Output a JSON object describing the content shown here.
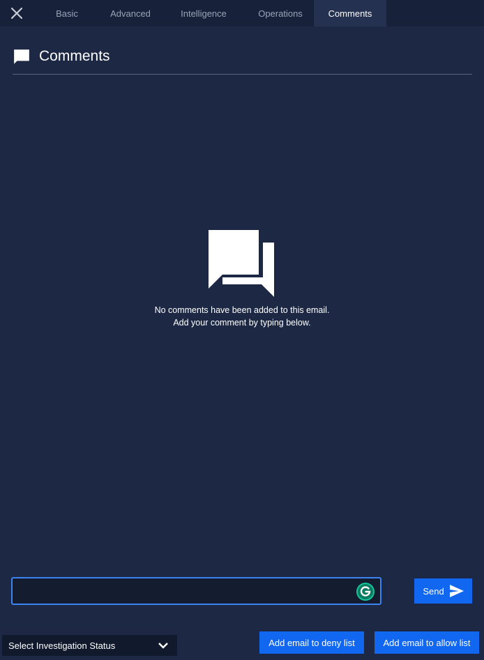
{
  "tabs": [
    {
      "label": "Basic",
      "active": false
    },
    {
      "label": "Advanced",
      "active": false
    },
    {
      "label": "Intelligence",
      "active": false
    },
    {
      "label": "Operations",
      "active": false
    },
    {
      "label": "Comments",
      "active": true
    }
  ],
  "header": {
    "title": "Comments",
    "icon": "comment-icon"
  },
  "empty_state": {
    "icon": "forum-icon",
    "line1": "No comments have been added to this email.",
    "line2": "Add your comment by typing below."
  },
  "comment_input": {
    "value": "",
    "placeholder": ""
  },
  "send_button": {
    "label": "Send",
    "icon": "send-icon"
  },
  "status_select": {
    "label": "Select Investigation Status",
    "icon": "chevron-down-icon"
  },
  "actions": {
    "deny_label": "Add email to deny list",
    "allow_label": "Add email to allow list"
  },
  "colors": {
    "background": "#1d2944",
    "tabbar": "#17213a",
    "active_tab": "#243150",
    "primary": "#1167f0",
    "input_border": "#3d83f5"
  }
}
